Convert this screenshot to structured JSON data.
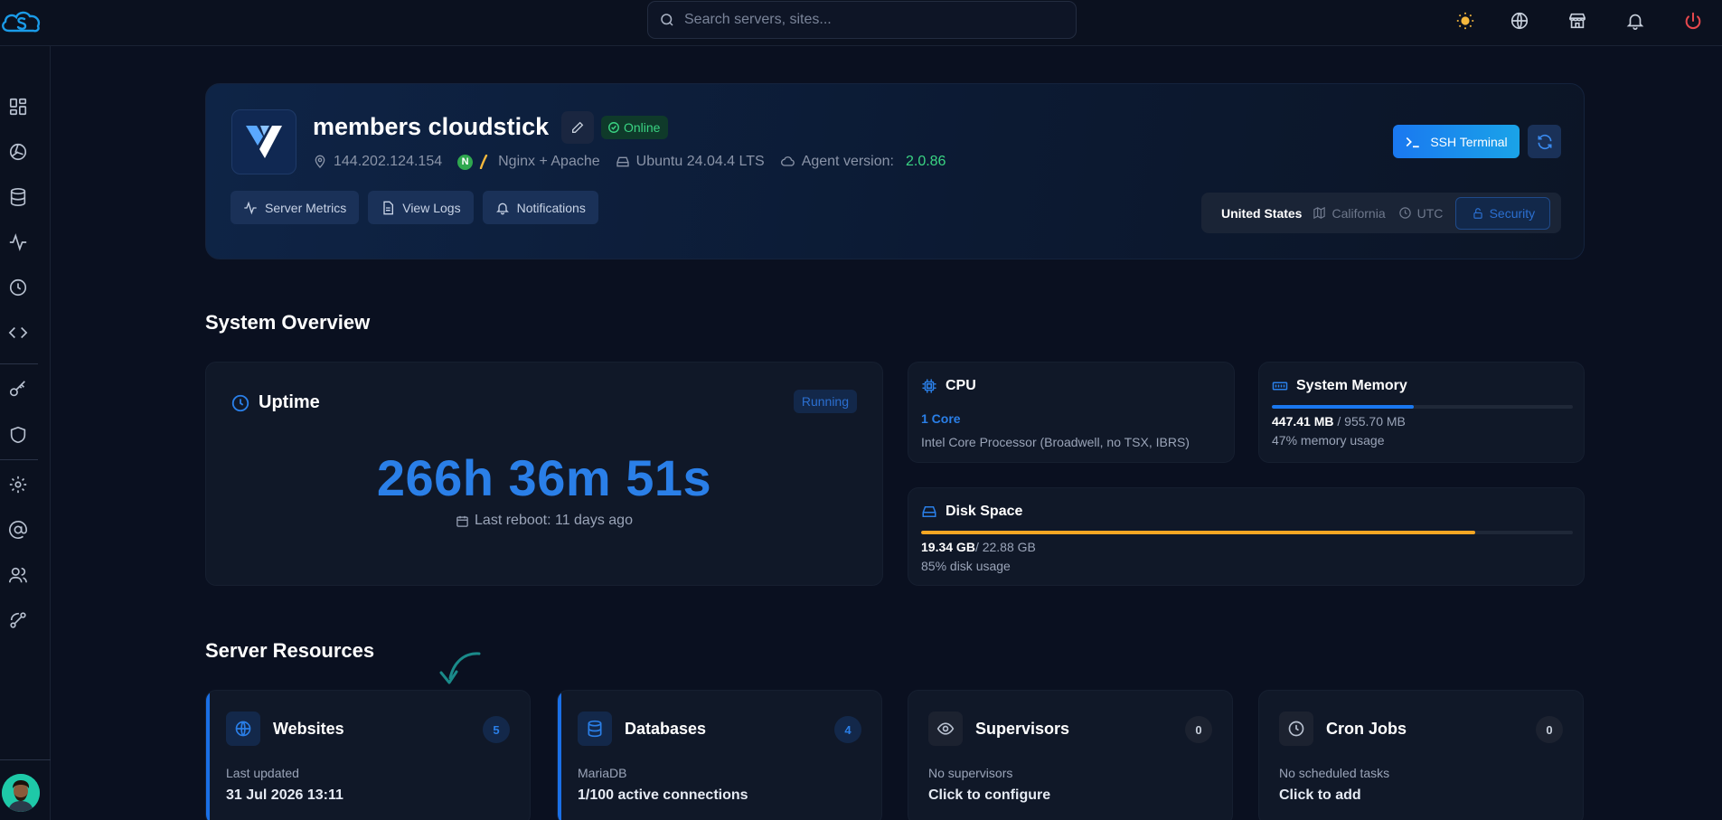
{
  "topbar": {
    "search_placeholder": "Search servers, sites...",
    "icons": [
      "sun-icon",
      "globe-icon",
      "store-icon",
      "bell-icon",
      "power-icon"
    ]
  },
  "sidebar": {
    "icons": [
      "dashboard-icon",
      "servers-icon",
      "database-icon",
      "activity-icon",
      "clock-icon",
      "code-icon",
      "key-icon",
      "shield-icon",
      "settings-icon",
      "at-icon",
      "users-icon",
      "route-icon"
    ]
  },
  "server": {
    "name": "members cloudstick",
    "status": "Online",
    "ip": "144.202.124.154",
    "web_server": "Nginx + Apache",
    "os": "Ubuntu 24.04.4 LTS",
    "agent_label": "Agent version:",
    "agent_version": "2.0.86",
    "buttons": {
      "metrics": "Server Metrics",
      "logs": "View Logs",
      "notifications": "Notifications",
      "ssh": "SSH Terminal"
    },
    "location": {
      "country": "United States",
      "region": "California",
      "timezone": "UTC",
      "security": "Security"
    }
  },
  "overview": {
    "title": "System Overview",
    "uptime": {
      "label": "Uptime",
      "badge": "Running",
      "value": "266h 36m 51s",
      "last_reboot": "Last reboot: 11 days ago"
    },
    "cpu": {
      "label": "CPU",
      "cores": "1 Core",
      "model": "Intel Core Processor (Broadwell, no TSX, IBRS)"
    },
    "memory": {
      "label": "System Memory",
      "used": "447.41 MB",
      "total": " / 955.70 MB",
      "usage_text": "47% memory usage",
      "percent": 47
    },
    "disk": {
      "label": "Disk Space",
      "used": "19.34 GB",
      "total": "/ 22.88 GB",
      "usage_text": "85% disk usage",
      "percent": 85
    }
  },
  "resources": {
    "title": "Server Resources",
    "cards": [
      {
        "title": "Websites",
        "count": "5",
        "sub": "Last updated",
        "main": "31 Jul 2026 13:11"
      },
      {
        "title": "Databases",
        "count": "4",
        "sub": "MariaDB",
        "main": "1/100 active connections"
      },
      {
        "title": "Supervisors",
        "count": "0",
        "sub": "No supervisors",
        "main": "Click to configure"
      },
      {
        "title": "Cron Jobs",
        "count": "0",
        "sub": "No scheduled tasks",
        "main": "Click to add"
      }
    ]
  },
  "colors": {
    "accent": "#1a78f0",
    "online": "#3ad483",
    "memory_bar": "#1a78f0",
    "disk_bar": "#f5a623",
    "power": "#e5484d"
  }
}
